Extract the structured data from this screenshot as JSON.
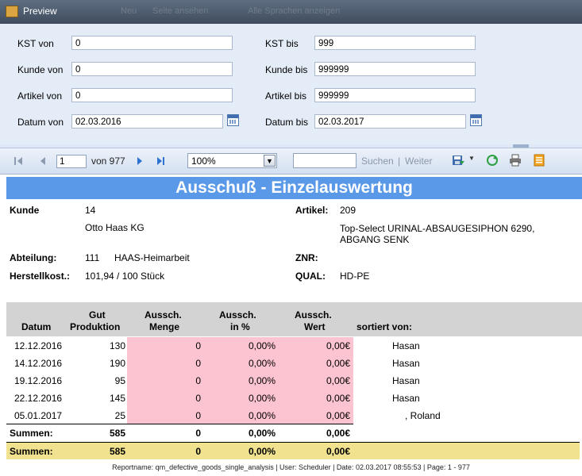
{
  "window": {
    "title": "Preview",
    "ghost_items": [
      "Neu",
      "Seite ansehen",
      "Alle Sprachen anzeigen"
    ]
  },
  "params": {
    "kst_von": {
      "label": "KST von",
      "value": "0"
    },
    "kst_bis": {
      "label": "KST bis",
      "value": "999"
    },
    "kunde_von": {
      "label": "Kunde von",
      "value": "0"
    },
    "kunde_bis": {
      "label": "Kunde bis",
      "value": "999999"
    },
    "artikel_von": {
      "label": "Artikel von",
      "value": "0"
    },
    "artikel_bis": {
      "label": "Artikel bis",
      "value": "999999"
    },
    "datum_von": {
      "label": "Datum von",
      "value": "02.03.2016"
    },
    "datum_bis": {
      "label": "Datum bis",
      "value": "02.03.2017"
    }
  },
  "toolbar": {
    "page": "1",
    "of_pages": "von 977",
    "zoom": "100%",
    "find": "Suchen",
    "separator": "|",
    "next": "Weiter",
    "icons": [
      "first-page-icon",
      "prev-page-icon",
      "next-page-icon",
      "last-page-icon",
      "export-icon",
      "refresh-icon",
      "print-icon",
      "page-setup-icon"
    ]
  },
  "report": {
    "title": "Ausschuß - Einzelauswertung",
    "kunde_label": "Kunde",
    "kunde_nr": "14",
    "kunde_name": "Otto Haas KG",
    "artikel_label": "Artikel:",
    "artikel_nr": "209",
    "artikel_desc_1": "Top-Select URINAL-ABSAUGESIPHON 6290,",
    "artikel_desc_2": "ABGANG SENK",
    "abteilung_label": "Abteilung:",
    "abteilung_nr": "111",
    "abteilung_name": "HAAS-Heimarbeit",
    "znr_label": "ZNR:",
    "znr_value": "",
    "herstell_label": "Herstellkost.:",
    "herstell_value": "101,94 / 100 Stück",
    "qual_label": "QUAL:",
    "qual_value": "HD-PE",
    "columns": {
      "datum": "Datum",
      "gut_1": "Gut",
      "gut_2": "Produktion",
      "menge_1": "Aussch.",
      "menge_2": "Menge",
      "proz_1": "Aussch.",
      "proz_2": "in %",
      "wert_1": "Aussch.",
      "wert_2": "Wert",
      "sortiert": "sortiert von:"
    },
    "rows": [
      {
        "datum": "12.12.2016",
        "gut": "130",
        "menge": "0",
        "proz": "0,00%",
        "wert": "0,00€",
        "sortiert": "Hasan"
      },
      {
        "datum": "14.12.2016",
        "gut": "190",
        "menge": "0",
        "proz": "0,00%",
        "wert": "0,00€",
        "sortiert": "Hasan"
      },
      {
        "datum": "19.12.2016",
        "gut": "95",
        "menge": "0",
        "proz": "0,00%",
        "wert": "0,00€",
        "sortiert": "Hasan"
      },
      {
        "datum": "22.12.2016",
        "gut": "145",
        "menge": "0",
        "proz": "0,00%",
        "wert": "0,00€",
        "sortiert": "Hasan"
      },
      {
        "datum": "05.01.2017",
        "gut": "25",
        "menge": "0",
        "proz": "0,00%",
        "wert": "0,00€",
        "sortiert": ", Roland"
      }
    ],
    "summen_label": "Summen:",
    "summen": {
      "gut": "585",
      "menge": "0",
      "proz": "0,00%",
      "wert": "0,00€"
    },
    "summen_total": {
      "gut": "585",
      "menge": "0",
      "proz": "0,00%",
      "wert": "0,00€"
    },
    "footer": "Reportname: qm_defective_goods_single_analysis | User: Scheduler | Date: 02.03.2017 08:55:53 | Page: 1 - 977"
  },
  "colors": {
    "title_band": "#5a98e8",
    "pink": "#fcc4d0",
    "total_band": "#f0e28e",
    "header_gray": "#d3d3d3"
  }
}
